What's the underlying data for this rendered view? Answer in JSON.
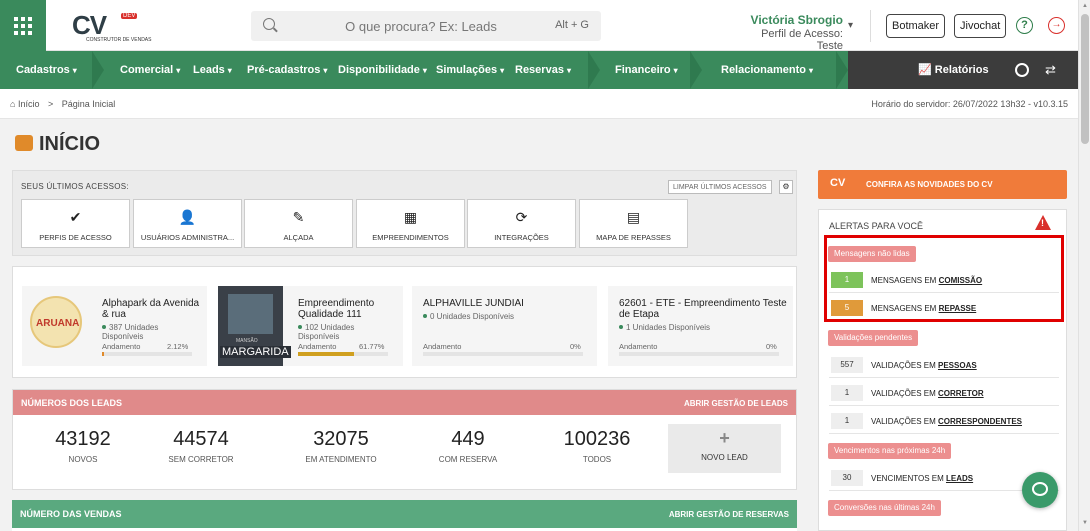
{
  "logo": {
    "text": "CV",
    "badge": "DEV",
    "subtitle": "CONSTRUTOR DE VENDAS"
  },
  "search": {
    "placeholder": "O que procura? Ex: Leads",
    "shortcut": "Alt + G"
  },
  "user": {
    "name": "Victória Sbrogio",
    "role": "Perfil de Acesso: Teste"
  },
  "header_buttons": {
    "botmaker": "Botmaker",
    "jivochat": "Jivochat",
    "help": "?",
    "logout": "→"
  },
  "nav": {
    "items": [
      "Cadastros",
      "Comercial",
      "Leads",
      "Pré-cadastros",
      "Disponibilidade",
      "Simulações",
      "Reservas",
      "Financeiro",
      "Relacionamento"
    ],
    "reports": "Relatórios",
    "swap": "⇄",
    "dropdown_glyph": "▾"
  },
  "breadcrumb": {
    "home": "Início",
    "sep": ">",
    "current": "Página Inicial",
    "server_time": "Horário do servidor: 26/07/2022 13h32 - v10.3.15"
  },
  "page_title": "INÍCIO",
  "last_access": {
    "label": "SEUS ÚLTIMOS ACESSOS:",
    "clear": "LIMPAR ÚLTIMOS ACESSOS",
    "items": [
      {
        "label": "PERFIS DE ACESSO",
        "icon": "✔"
      },
      {
        "label": "USUÁRIOS ADMINISTRA...",
        "icon": "👤"
      },
      {
        "label": "ALÇADA",
        "icon": "✎"
      },
      {
        "label": "EMPREENDIMENTOS",
        "icon": "▦"
      },
      {
        "label": "INTEGRAÇÕES",
        "icon": "⟳"
      },
      {
        "label": "MAPA DE REPASSES",
        "icon": "▤"
      }
    ]
  },
  "projects": [
    {
      "title": "Alphapark da Avenida & rua",
      "units": "387 Unidades Disponíveis",
      "progress_label": "Andamento",
      "progress": "2.12%",
      "progress_value": 2.12,
      "image_text": "ARUANA",
      "color": "#e08a2a"
    },
    {
      "title": "Empreendimento Qualidade 111",
      "units": "102 Unidades Disponíveis",
      "progress_label": "Andamento",
      "progress": "61.77%",
      "progress_value": 61.77,
      "image_text": "MARGARIDA",
      "image_subtext": "MANSÃO",
      "color": "#d0a020"
    },
    {
      "title": "ALPHAVILLE JUNDIAI",
      "units": "0 Unidades Disponíveis",
      "progress_label": "Andamento",
      "progress": "0%",
      "progress_value": 0,
      "color": "#3a8a5c"
    },
    {
      "title": "62601 - ETE - Empreendimento Teste de Etapa",
      "units": "1 Unidades Disponíveis",
      "progress_label": "Andamento",
      "progress": "0%",
      "progress_value": 0,
      "color": "#3a8a5c"
    }
  ],
  "leads": {
    "title": "NÚMEROS DOS LEADS",
    "action": "ABRIR GESTÃO DE LEADS",
    "stats": [
      {
        "value": "43192",
        "label": "NOVOS"
      },
      {
        "value": "44574",
        "label": "SEM CORRETOR"
      },
      {
        "value": "32075",
        "label": "EM ATENDIMENTO"
      },
      {
        "value": "449",
        "label": "COM RESERVA"
      },
      {
        "value": "100236",
        "label": "TODOS"
      }
    ],
    "new_lead_plus": "+",
    "new_lead": "NOVO LEAD"
  },
  "sales": {
    "title": "NÚMERO DAS VENDAS",
    "action": "ABRIR GESTÃO DE RESERVAS"
  },
  "news": {
    "logo": "CV",
    "title": "CONFIRA AS NOVIDADES DO CV"
  },
  "alerts": {
    "title": "ALERTAS PARA VOCÊ",
    "warn": "!",
    "groups": [
      {
        "tag": "Mensagens não lidas",
        "rows": [
          {
            "count": "1",
            "prefix": "MENSAGENS EM",
            "target": "COMISSÃO",
            "color": "#7dc35b"
          },
          {
            "count": "5",
            "prefix": "MENSAGENS EM",
            "target": "REPASSE",
            "color": "#e09a3a"
          }
        ]
      },
      {
        "tag": "Validações pendentes",
        "rows": [
          {
            "count": "557",
            "prefix": "VALIDAÇÕES EM",
            "target": "PESSOAS",
            "color": "#eeeeee"
          },
          {
            "count": "1",
            "prefix": "VALIDAÇÕES EM",
            "target": "CORRETOR",
            "color": "#eeeeee"
          },
          {
            "count": "1",
            "prefix": "VALIDAÇÕES EM",
            "target": "CORRESPONDENTES",
            "color": "#eeeeee"
          }
        ]
      },
      {
        "tag": "Vencimentos nas próximas 24h",
        "rows": [
          {
            "count": "30",
            "prefix": "VENCIMENTOS EM",
            "target": "LEADS",
            "color": "#eeeeee"
          }
        ]
      },
      {
        "tag": "Conversões nas últimas 24h",
        "rows": []
      }
    ]
  }
}
